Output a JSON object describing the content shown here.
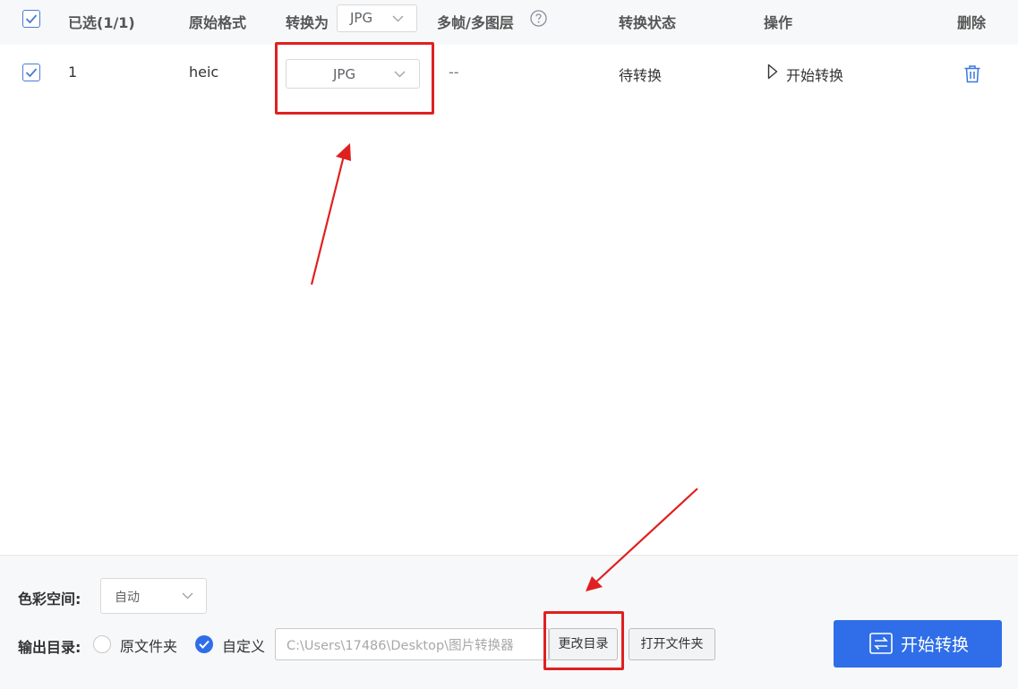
{
  "header": {
    "selected_label": "已选(1/1)",
    "original_format_label": "原始格式",
    "convert_to_label": "转换为",
    "convert_to_value": "JPG",
    "multiframe_label": "多帧/多图层",
    "status_label": "转换状态",
    "action_label": "操作",
    "delete_label": "删除"
  },
  "rows": [
    {
      "index": "1",
      "original_format": "heic",
      "target_format": "JPG",
      "multiframe": "--",
      "status": "待转换",
      "action": "开始转换"
    }
  ],
  "footer": {
    "color_space_label": "色彩空间:",
    "color_space_value": "自动",
    "output_dir_label": "输出目录:",
    "option_original": "原文件夹",
    "option_custom": "自定义",
    "path_value": "C:\\Users\\17486\\Desktop\\图片转换器",
    "change_dir_button": "更改目录",
    "open_folder_button": "打开文件夹",
    "start_button": "开始转换"
  },
  "colors": {
    "accent": "#2f6ee8",
    "annotation": "#e02020",
    "header_bg": "#f7f8fa"
  }
}
